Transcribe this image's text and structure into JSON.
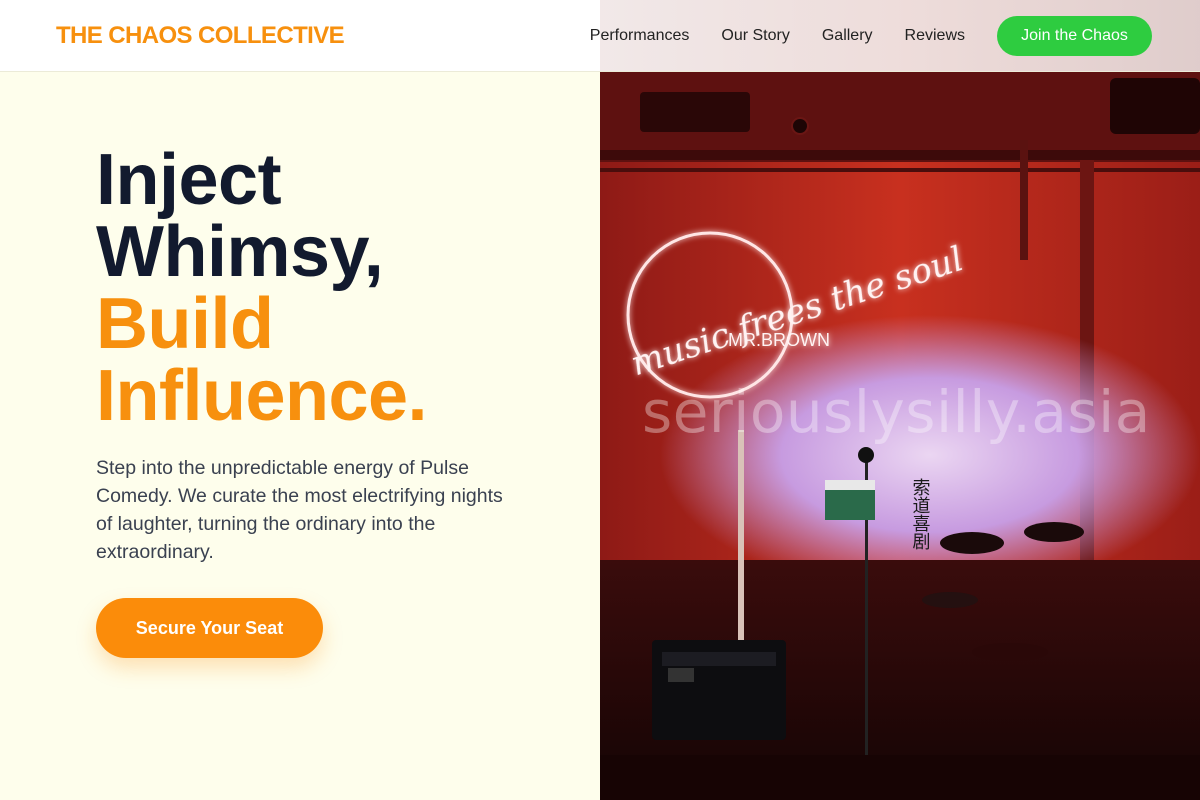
{
  "header": {
    "logo": "THE CHAOS COLLECTIVE",
    "nav": [
      "Performances",
      "Our Story",
      "Gallery",
      "Reviews"
    ],
    "cta_label": "Join the Chaos"
  },
  "hero": {
    "headline_line1": "Inject",
    "headline_line2": "Whimsy,",
    "headline_line3": "Build",
    "headline_line4": "Influence.",
    "description": "Step into the unpredictable energy of Pulse Comedy. We curate the most electrifying nights of laughter, turning the ordinary into the extraordinary.",
    "cta_label": "Secure Your Seat"
  },
  "image": {
    "neon_text": "music frees the soul",
    "neon_sub": "MR.BROWN",
    "watermark": "seriouslysilly.asia",
    "signage": "索道喜剧"
  },
  "colors": {
    "accent_orange": "#f7900e",
    "dark_text": "#121a2e",
    "join_green": "#2ecc40",
    "page_bg": "#fefeec"
  }
}
